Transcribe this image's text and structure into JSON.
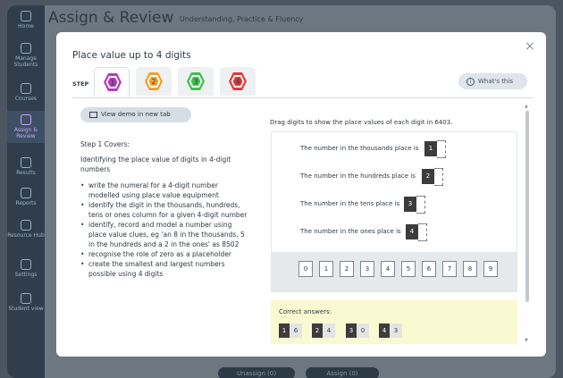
{
  "nav": {
    "items": [
      {
        "label": "Home",
        "icon": "home-icon"
      },
      {
        "label": "Manage Students",
        "icon": "students-icon"
      },
      {
        "label": "Courses",
        "icon": "courses-icon"
      },
      {
        "label": "Assign & Review",
        "icon": "assign-icon"
      },
      {
        "label": "Results",
        "icon": "results-icon"
      },
      {
        "label": "Reports",
        "icon": "reports-icon"
      },
      {
        "label": "Resource Hub",
        "icon": "resource-icon"
      },
      {
        "label": "Settings",
        "icon": "settings-icon"
      },
      {
        "label": "Student view",
        "icon": "student-view-icon"
      }
    ]
  },
  "app": {
    "title": "Assign & Review",
    "subtitle": "Understanding, Practice & Fluency",
    "unassign_label": "Unassign (0)",
    "assign_label": "Assign (0)"
  },
  "modal": {
    "title": "Place value up to 4 digits",
    "step_label": "STEP",
    "steps": [
      {
        "label": "1",
        "color": "#b23bb8"
      },
      {
        "label": "2",
        "color": "#f0a030"
      },
      {
        "label": "3",
        "color": "#3fbe4f"
      },
      {
        "label": "4",
        "color": "#e03a3a"
      }
    ],
    "whats_this": "What's this",
    "info_glyph": "i",
    "close_glyph": "×"
  },
  "left": {
    "demo_button": "View demo in new tab",
    "covers_title": "Step 1 Covers:",
    "intro": "Identifying the place value of digits in 4-digit numbers",
    "bullets": [
      "write the numeral for a 4-digit number modelled using place value equipment",
      "identify the digit in the thousands, hundreds, tens or ones column for a given 4-digit number",
      "identify, record and model a number using place value clues, eg 'an 8 in the thousands, 5 in the hundreds and a 2 in the ones' as 8502",
      "recognise the role of zero as a placeholder",
      "create the smallest and largest numbers possible using 4 digits"
    ]
  },
  "right": {
    "instruction": "Drag digits to show the place values of each digit in 6403.",
    "rows": [
      {
        "text": "The number in the thousands place is",
        "digit": "1"
      },
      {
        "text": "The number in the hundreds place is",
        "digit": "2"
      },
      {
        "text": "The number in the tens place is",
        "digit": "3"
      },
      {
        "text": "The number in the ones place is",
        "digit": "4"
      }
    ],
    "tiles": [
      "0",
      "1",
      "2",
      "3",
      "4",
      "5",
      "6",
      "7",
      "8",
      "9"
    ],
    "answers_label": "Correct answers:",
    "answers": [
      {
        "key": "1",
        "value": "6"
      },
      {
        "key": "2",
        "value": "4"
      },
      {
        "key": "3",
        "value": "0"
      },
      {
        "key": "4",
        "value": "3"
      }
    ]
  }
}
